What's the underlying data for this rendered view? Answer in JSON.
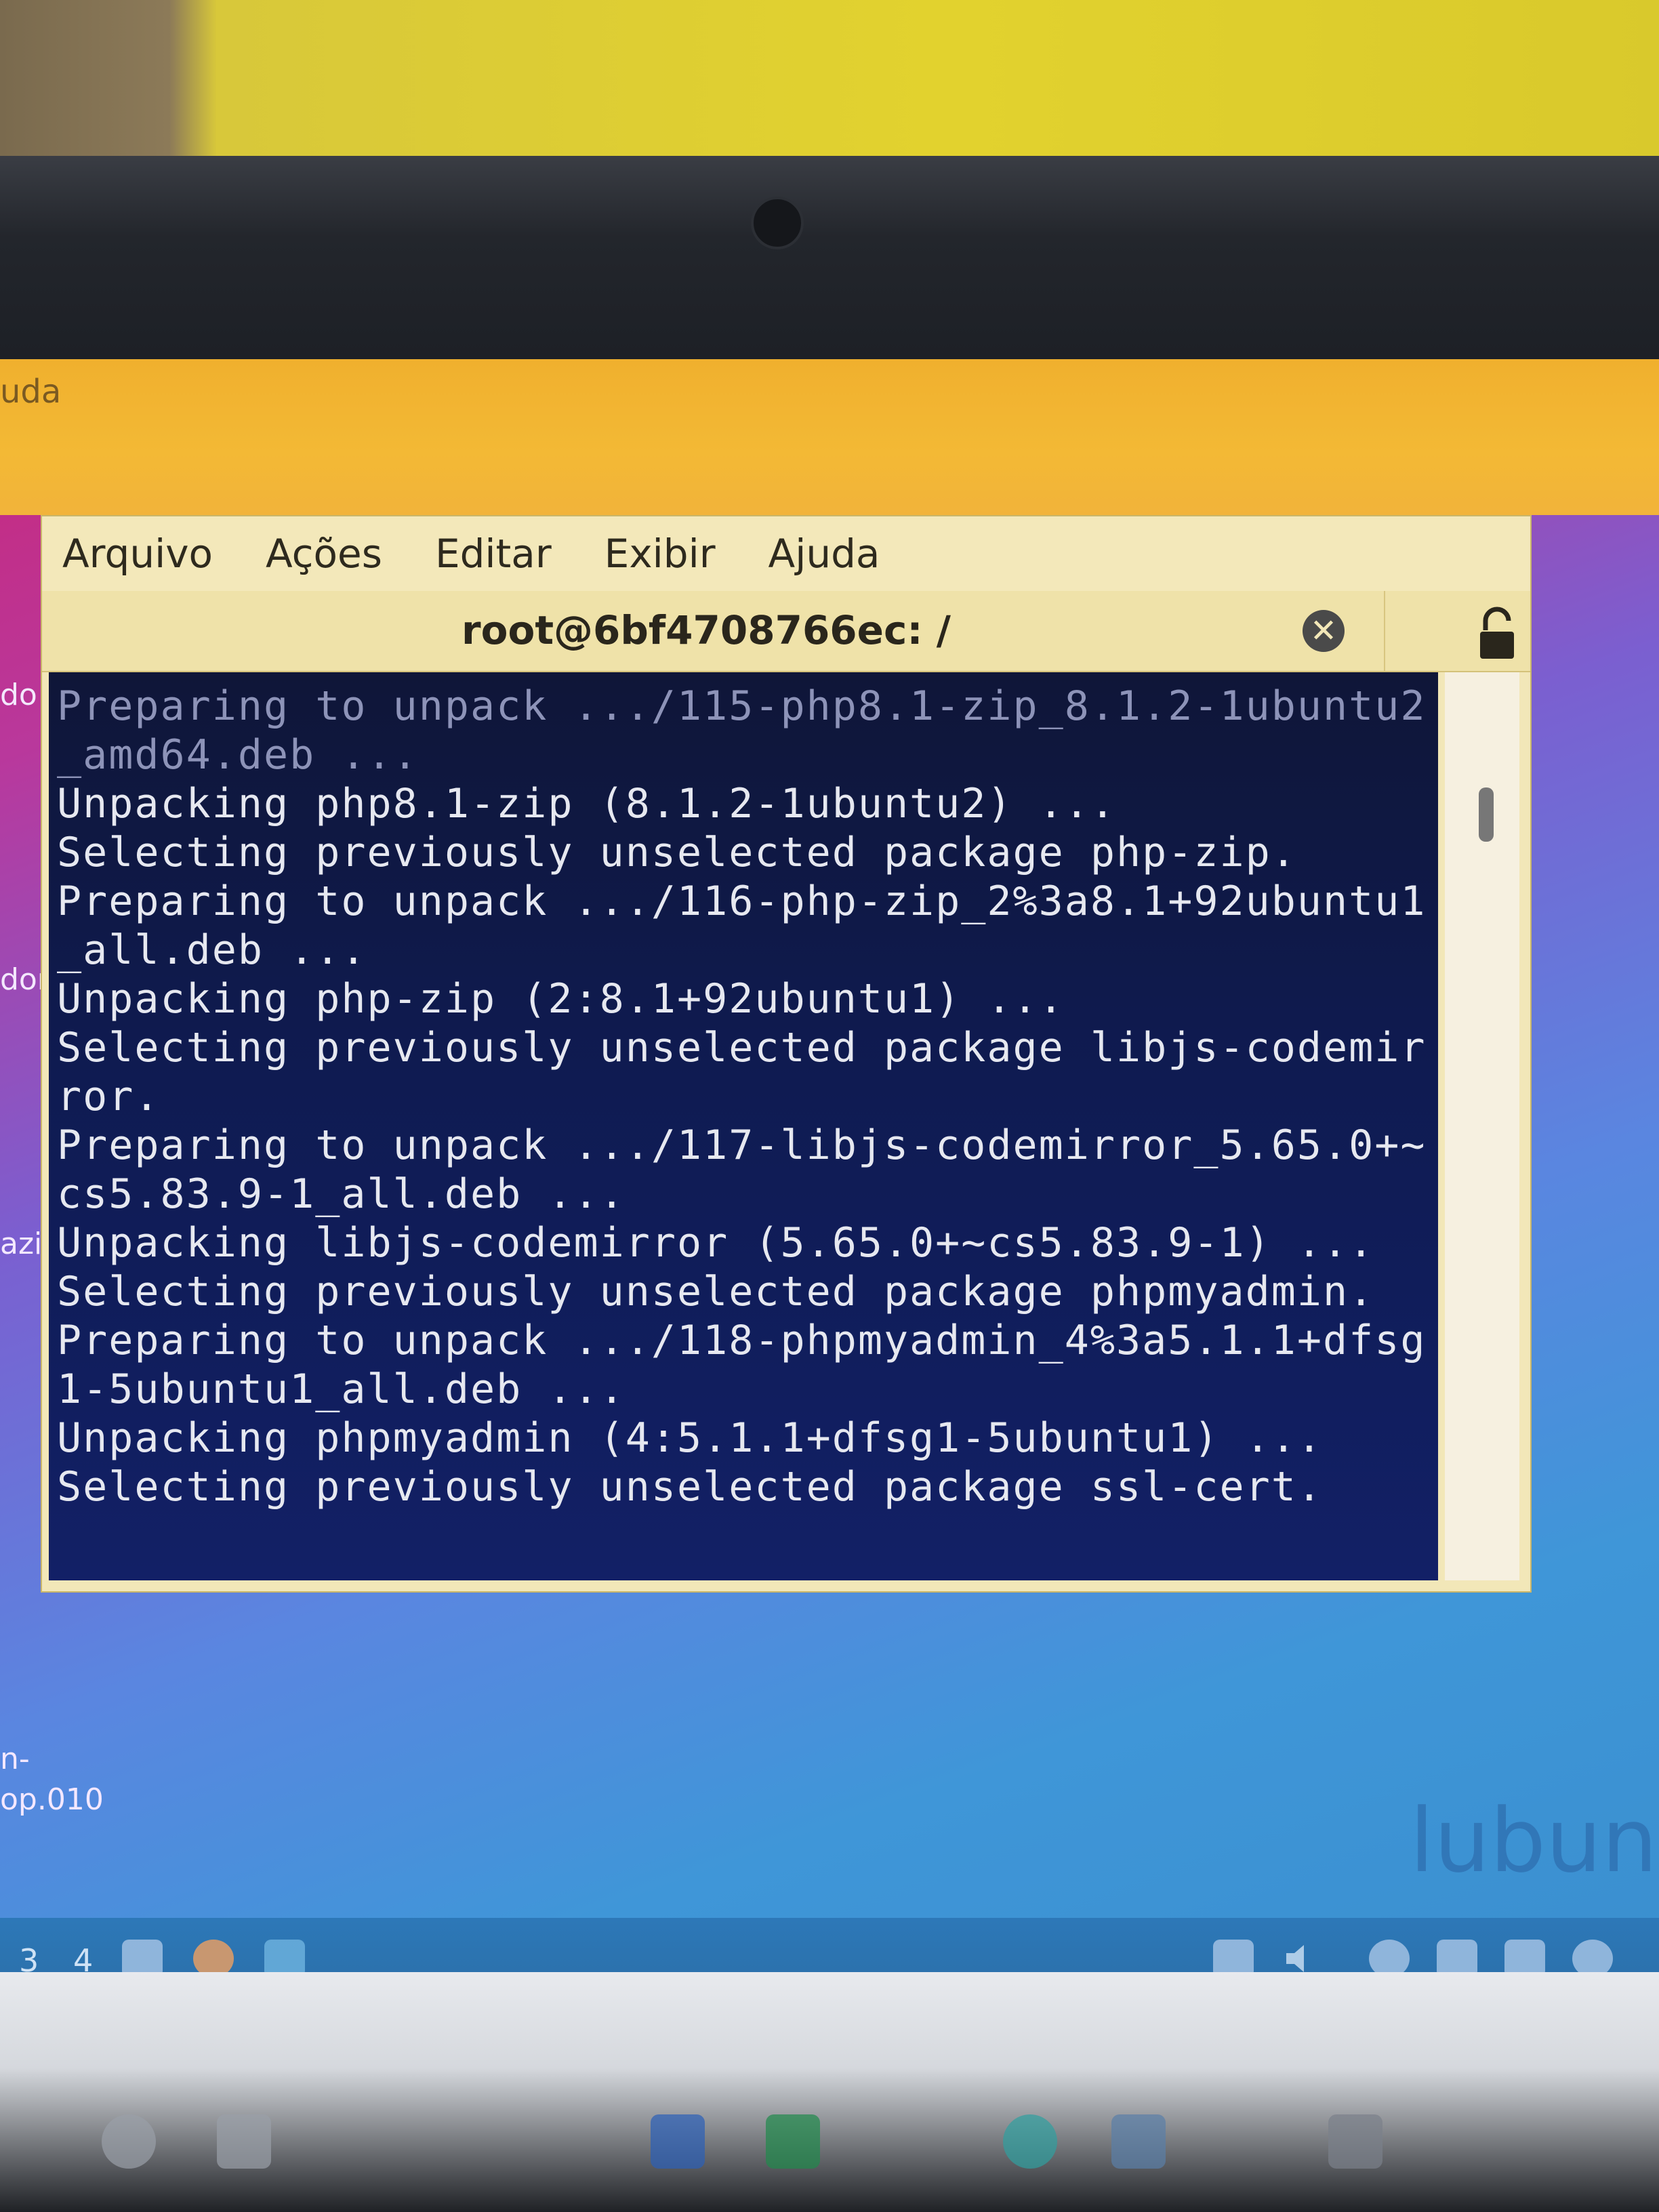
{
  "behind_window": {
    "menu_fragment": "uda"
  },
  "desktop_labels": [
    "do",
    "dor",
    "azia)",
    "n-",
    "op.010"
  ],
  "terminal": {
    "menu": [
      "Arquivo",
      "Ações",
      "Editar",
      "Exibir",
      "Ajuda"
    ],
    "tab_title": "root@6bf4708766ec: /",
    "lines": [
      "Preparing to unpack .../115-php8.1-zip_8.1.2-1ubuntu2",
      "_amd64.deb ...",
      "Unpacking php8.1-zip (8.1.2-1ubuntu2) ...",
      "Selecting previously unselected package php-zip.",
      "Preparing to unpack .../116-php-zip_2%3a8.1+92ubuntu1",
      "_all.deb ...",
      "Unpacking php-zip (2:8.1+92ubuntu1) ...",
      "Selecting previously unselected package libjs-codemir",
      "ror.",
      "Preparing to unpack .../117-libjs-codemirror_5.65.0+~",
      "cs5.83.9-1_all.deb ...",
      "Unpacking libjs-codemirror (5.65.0+~cs5.83.9-1) ...",
      "Selecting previously unselected package phpmyadmin.",
      "Preparing to unpack .../118-phpmyadmin_4%3a5.1.1+dfsg",
      "1-5ubuntu1_all.deb ...",
      "Unpacking phpmyadmin (4:5.1.1+dfsg1-5ubuntu1) ...",
      "Selecting previously unselected package ssl-cert."
    ]
  },
  "taskbar": {
    "workspaces": [
      "3",
      "4"
    ]
  },
  "wallpaper_logo": "lubuntu",
  "colors": {
    "terminal_bg": "#0f1b52",
    "window_chrome": "#f2e7b8",
    "panel": "#2d78b8"
  }
}
